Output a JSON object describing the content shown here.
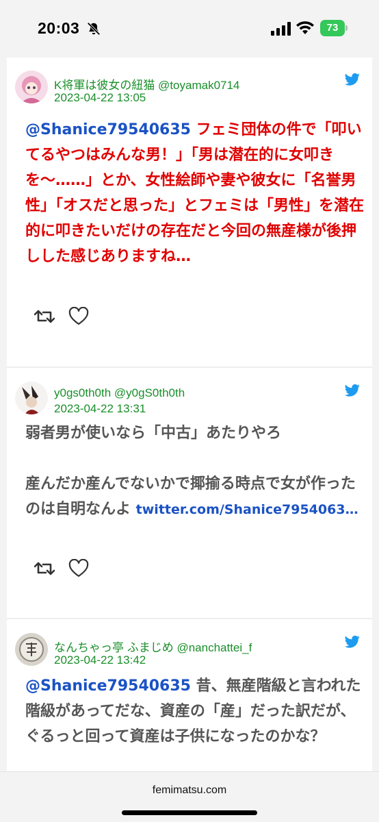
{
  "status_bar": {
    "time": "20:03",
    "battery": "73"
  },
  "tweets": [
    {
      "user": "K将軍は彼女の紐猫 @toyamak0714",
      "date": "2023-04-22 13:05",
      "mention": "@Shanice79540635",
      "body": " フェミ団体の件で「叩いてるやつはみんな男！」「男は潜在的に女叩きを〜……」とか、女性絵師や妻や彼女に「名誉男性」「オスだと思った」とフェミは「男性」を潜在的に叩きたいだけの存在だと今回の無産様が後押しした感じありますね…"
    },
    {
      "user": "y0gs0th0th @y0gS0th0th",
      "date": "2023-04-22 13:31",
      "para1": "弱者男が使いなら「中古」あたりやろ",
      "para2": "産んだか産んでないかで揶揄る時点で女が作ったのは自明なんよ ",
      "link": "twitter.com/Shanice7954063…"
    },
    {
      "user": "なんちゃっ亭 ふまじめ @nanchattei_f",
      "date": "2023-04-22 13:42",
      "mention": "@Shanice79540635",
      "body": " 昔、無産階級と言われた階級があってだな、資産の「産」だった訳だが、ぐるっと回って資産は子供になったのかな？"
    }
  ],
  "footer": {
    "url": "femimatsu.com"
  },
  "colors": {
    "accent_green": "#1a8f2a",
    "mention_blue": "#1a52c4",
    "alert_red": "#e00000",
    "twitter_blue": "#1d9bf0"
  },
  "icons": [
    "bell-slash-icon",
    "signal-icon",
    "wifi-icon",
    "battery-icon",
    "twitter-bird-icon",
    "retweet-icon",
    "heart-icon"
  ]
}
